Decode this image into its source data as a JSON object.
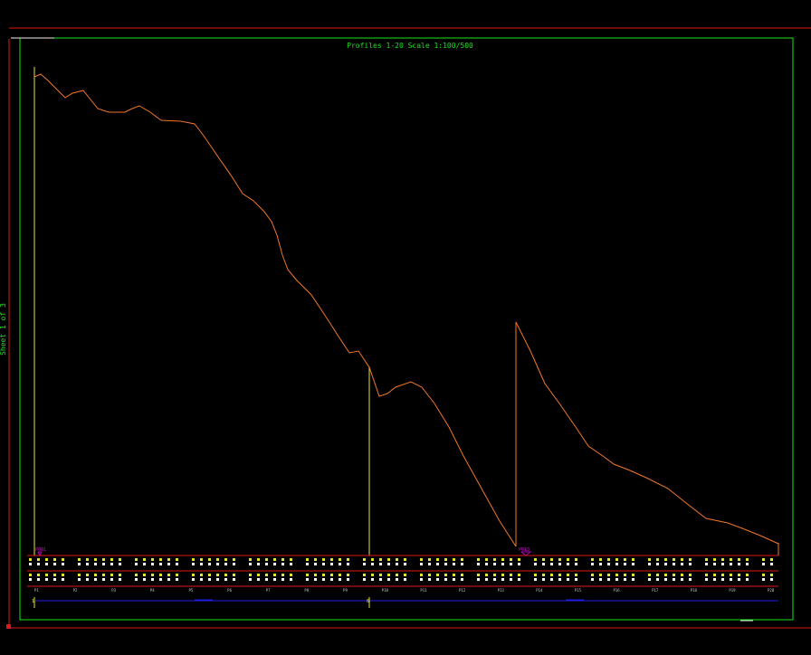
{
  "sheet": {
    "title": "Profiles 1-20   Scale 1:100/500",
    "side_label": "Sheet 1 of 3"
  },
  "colors": {
    "background": "#000000",
    "outer_frame": "#e01818",
    "inner_frame": "#19e619",
    "profile_line": "#f07828",
    "vertical_marker": "#e6e632",
    "grid_lines": "#e01818",
    "label_text": "#e6e632",
    "value_text": "#ffffff",
    "station_marker": "#e000e0",
    "baseline": "#1e1ee6",
    "title_text": "#19e619"
  },
  "markers": [
    {
      "text": "P001"
    },
    {
      "text": "P013"
    }
  ],
  "profile": {
    "points": [
      [
        38,
        85
      ],
      [
        45,
        82
      ],
      [
        52,
        88
      ],
      [
        60,
        96
      ],
      [
        72,
        108
      ],
      [
        80,
        103
      ],
      [
        92,
        100
      ],
      [
        100,
        110
      ],
      [
        108,
        120
      ],
      [
        120,
        124
      ],
      [
        138,
        124
      ],
      [
        146,
        120
      ],
      [
        154,
        117
      ],
      [
        166,
        124
      ],
      [
        178,
        133
      ],
      [
        200,
        134
      ],
      [
        215,
        137
      ],
      [
        225,
        150
      ],
      [
        240,
        172
      ],
      [
        256,
        195
      ],
      [
        268,
        214
      ],
      [
        280,
        222
      ],
      [
        292,
        234
      ],
      [
        300,
        245
      ],
      [
        306,
        260
      ],
      [
        312,
        282
      ],
      [
        318,
        298
      ],
      [
        328,
        310
      ],
      [
        344,
        326
      ],
      [
        360,
        350
      ],
      [
        376,
        375
      ],
      [
        386,
        390
      ],
      [
        396,
        388
      ],
      [
        408,
        406
      ],
      [
        419,
        438
      ],
      [
        428,
        435
      ],
      [
        437,
        428
      ],
      [
        454,
        422
      ],
      [
        466,
        428
      ],
      [
        480,
        446
      ],
      [
        496,
        472
      ],
      [
        512,
        504
      ],
      [
        532,
        540
      ],
      [
        552,
        576
      ],
      [
        570,
        604
      ]
    ],
    "second_segment": [
      [
        570,
        356
      ],
      [
        586,
        388
      ],
      [
        602,
        424
      ],
      [
        618,
        446
      ],
      [
        636,
        472
      ],
      [
        650,
        493
      ],
      [
        666,
        504
      ],
      [
        678,
        513
      ],
      [
        696,
        520
      ],
      [
        714,
        528
      ],
      [
        738,
        540
      ],
      [
        758,
        556
      ],
      [
        780,
        573
      ],
      [
        804,
        578
      ],
      [
        820,
        584
      ],
      [
        840,
        592
      ],
      [
        860,
        601
      ]
    ]
  },
  "vertical_markers": [
    {
      "label": "1"
    },
    {
      "label": "10"
    },
    {
      "label": "14"
    }
  ],
  "station_labels": [
    "P1",
    "P2",
    "P3",
    "P4",
    "P5",
    "P6",
    "P7",
    "P8",
    "P9",
    "P10",
    "P11",
    "P12",
    "P13",
    "P14",
    "P15",
    "P16",
    "P17",
    "P18",
    "P19",
    "P20"
  ],
  "baseline_labels": [
    "1",
    "6"
  ]
}
